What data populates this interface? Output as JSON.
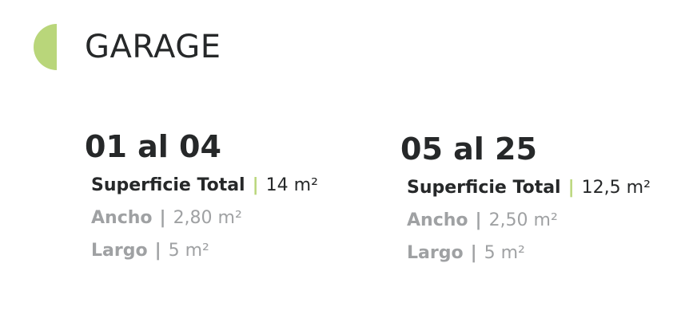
{
  "colors": {
    "accent": "#b9d67a",
    "text_dark": "#262829",
    "text_muted": "#9fa1a3"
  },
  "icon": "half-circle-accent",
  "title": "GARAGE",
  "blocks": [
    {
      "heading": "01 al 04",
      "specs": [
        {
          "label": "Superficie Total",
          "sep": "|",
          "value": "14 m²"
        },
        {
          "label": "Ancho",
          "sep": "|",
          "value": "2,80 m²"
        },
        {
          "label": "Largo",
          "sep": "|",
          "value": "5 m²"
        }
      ]
    },
    {
      "heading": "05 al 25",
      "specs": [
        {
          "label": "Superficie Total",
          "sep": "|",
          "value": "12,5 m²"
        },
        {
          "label": "Ancho",
          "sep": "|",
          "value": "2,50 m²"
        },
        {
          "label": "Largo",
          "sep": "|",
          "value": "5 m²"
        }
      ]
    }
  ]
}
